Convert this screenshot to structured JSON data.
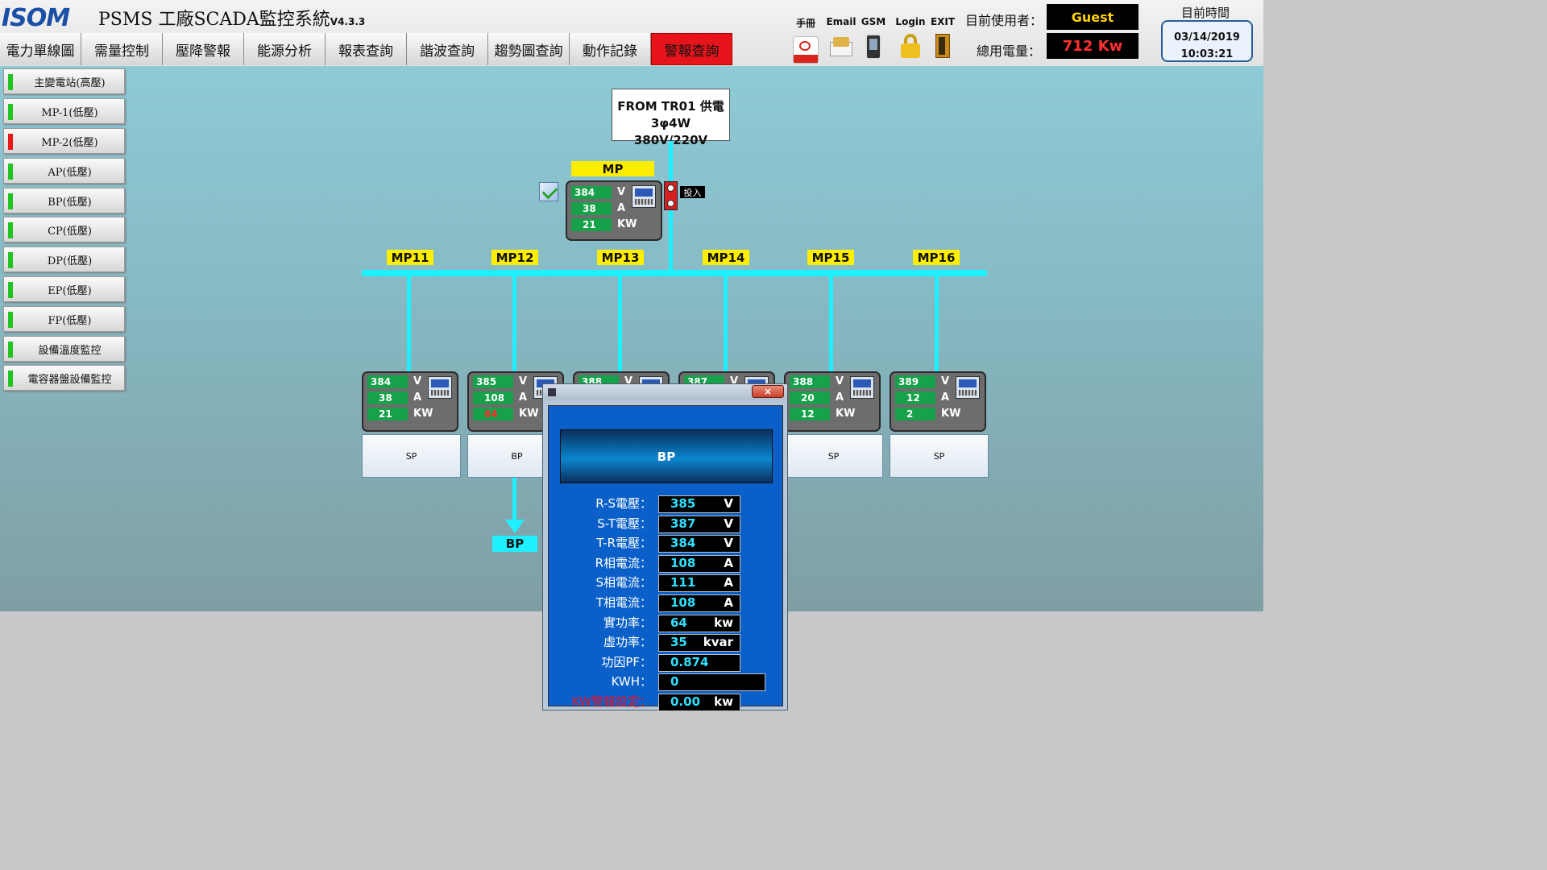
{
  "app": {
    "logo": "ISOM",
    "title": "PSMS 工廠SCADA監控系統",
    "version": "V4.3.3"
  },
  "nav": [
    "電力單線圖",
    "需量控制",
    "壓降警報",
    "能源分析",
    "報表查詢",
    "諧波查詢",
    "趨勢圖查詢",
    "動作記錄",
    "警報查詢"
  ],
  "toolbar": [
    {
      "label": "手冊",
      "icon": "pdf-icon",
      "color": "#d9261c"
    },
    {
      "label": "Email",
      "icon": "envelope-icon",
      "color": "#e0b24a"
    },
    {
      "label": "GSM",
      "icon": "phone-icon",
      "color": "#333333"
    },
    {
      "label": "Login",
      "icon": "lock-icon",
      "color": "#f0c020"
    },
    {
      "label": "EXIT",
      "icon": "exit-door-icon",
      "color": "#c98a1a"
    }
  ],
  "user": {
    "label": "目前使用者：",
    "value": "Guest"
  },
  "power": {
    "label": "總用電量：",
    "value": "712 Kw"
  },
  "clock": {
    "label": "目前時間",
    "date": "03/14/2019",
    "time": "10:03:21"
  },
  "sidebar": [
    {
      "label": "主變電站(高壓)",
      "status": "green"
    },
    {
      "label": "MP-1(低壓)",
      "status": "green"
    },
    {
      "label": "MP-2(低壓)",
      "status": "red"
    },
    {
      "label": "AP(低壓)",
      "status": "green"
    },
    {
      "label": "BP(低壓)",
      "status": "green"
    },
    {
      "label": "CP(低壓)",
      "status": "green"
    },
    {
      "label": "DP(低壓)",
      "status": "green"
    },
    {
      "label": "EP(低壓)",
      "status": "green"
    },
    {
      "label": "FP(低壓)",
      "status": "green"
    },
    {
      "label": "設備溫度監控",
      "status": "green"
    },
    {
      "label": "電容器盤設備監控",
      "status": "green"
    }
  ],
  "status_colors": {
    "green": "#22c322",
    "red": "#e81818"
  },
  "source": {
    "line1": "FROM TR01 供電",
    "line2": "3φ4W 380V/220V"
  },
  "main": {
    "label": "MP",
    "breaker_label": "投入",
    "meter": {
      "v": "384",
      "a": "38",
      "kw": "21"
    }
  },
  "units": {
    "v": "V",
    "a": "A",
    "kw": "KW"
  },
  "feeders": [
    {
      "label": "MP11",
      "v": "384",
      "a": "38",
      "kw": "21",
      "kw_alarm": false,
      "panel": "SP"
    },
    {
      "label": "MP12",
      "v": "385",
      "a": "108",
      "kw": "64",
      "kw_alarm": true,
      "panel": "BP"
    },
    {
      "label": "MP13",
      "v": "388",
      "a": "",
      "kw": "",
      "kw_alarm": false,
      "panel": ""
    },
    {
      "label": "MP14",
      "v": "387",
      "a": "",
      "kw": "",
      "kw_alarm": false,
      "panel": ""
    },
    {
      "label": "MP15",
      "v": "388",
      "a": "20",
      "kw": "12",
      "kw_alarm": false,
      "panel": "SP"
    },
    {
      "label": "MP16",
      "v": "389",
      "a": "12",
      "kw": "2",
      "kw_alarm": false,
      "panel": "SP"
    }
  ],
  "bp_label": "BP",
  "popup": {
    "close": "×",
    "title": "BP",
    "rows": [
      {
        "label": "R-S電壓：",
        "value": "385",
        "unit": "V"
      },
      {
        "label": "S-T電壓：",
        "value": "387",
        "unit": "V"
      },
      {
        "label": "T-R電壓：",
        "value": "384",
        "unit": "V"
      },
      {
        "label": "R相電流：",
        "value": "108",
        "unit": "A"
      },
      {
        "label": "S相電流：",
        "value": "111",
        "unit": "A"
      },
      {
        "label": "T相電流：",
        "value": "108",
        "unit": "A"
      },
      {
        "label": "實功率：",
        "value": "64",
        "unit": "kw"
      },
      {
        "label": "虛功率：",
        "value": "35",
        "unit": "kvar"
      },
      {
        "label": "功因PF：",
        "value": "0.874",
        "unit": ""
      },
      {
        "label": "KWH：",
        "value": "0",
        "unit": ""
      },
      {
        "label": "KW警報設定：",
        "value": "0.00",
        "unit": "kw"
      }
    ]
  }
}
